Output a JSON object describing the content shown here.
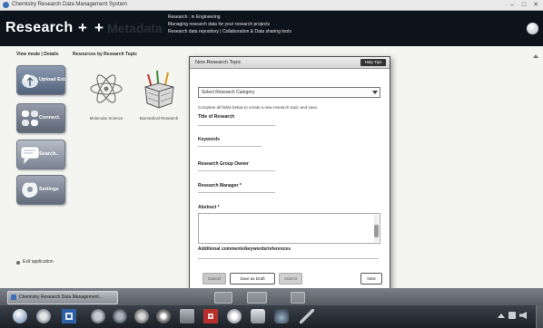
{
  "window": {
    "title": "Chemistry Research Data Management System",
    "minimize": "–",
    "maximize": "□",
    "close": "✕"
  },
  "header": {
    "brand": "Research",
    "brand_plus": "+",
    "secondary_plus": "+",
    "secondary": "Metadata",
    "info_lines": [
      "Research : in Engineering",
      "Managing research data for your research projects",
      "Research data repository | Collaboration & Data sharing tools"
    ],
    "user_icon": "user-circle-icon"
  },
  "view_tabs": {
    "view_mode": "View mode | Details",
    "resources": "Resources by Research Topic"
  },
  "sidebar": {
    "tiles": [
      {
        "label": "Upload Ext.",
        "icon": "upload-icon"
      },
      {
        "label": "Connect.",
        "icon": "connect-icon"
      },
      {
        "label": "Search..",
        "icon": "search-icon"
      },
      {
        "label": "Settings",
        "icon": "settings-icon"
      }
    ]
  },
  "topics": [
    {
      "label": "Molecular Science",
      "icon": "atom-icon"
    },
    {
      "label": "Biomedical Research",
      "icon": "basket-icon"
    }
  ],
  "exit": {
    "label": "Exit application"
  },
  "dialog": {
    "title": "New Research Topic",
    "help_button": "Help Tips",
    "category_select": {
      "value": "Select Research Category"
    },
    "instruction": "Complete all fields below to create a new research topic and save.",
    "fields": [
      {
        "label": "Title of Research"
      },
      {
        "label": "Keywords"
      },
      {
        "label": "Research Group Owner"
      },
      {
        "label": "Research Manager *"
      },
      {
        "label": "Abstract *"
      },
      {
        "label": "Additional comments/keywords/references"
      }
    ],
    "buttons": {
      "cancel": "Cancel",
      "save_draft": "Save as Draft",
      "submit": "Submit",
      "next": "Next"
    }
  },
  "taskbar": {
    "window_button": "Chemistry Research Data Management...",
    "pinned_icons": [
      "start-button-icon",
      "browser-icon",
      "word-icon",
      "media-player-icon",
      "globe-icon",
      "firefox-icon",
      "chrome-icon",
      "folder-icon",
      "pdf-icon",
      "disc-icon",
      "phone-icon",
      "bird-icon",
      "pen-icon"
    ],
    "tray_icons": [
      "show-hidden-icon",
      "flag-icon",
      "volume-icon"
    ]
  },
  "colors": {
    "header_bg": "#0d131b",
    "brand_text": "#ffffff",
    "tile_blue": "#51627a",
    "dialog_border": "#4c4c4c",
    "taskbar_bg": "#1c2027"
  }
}
